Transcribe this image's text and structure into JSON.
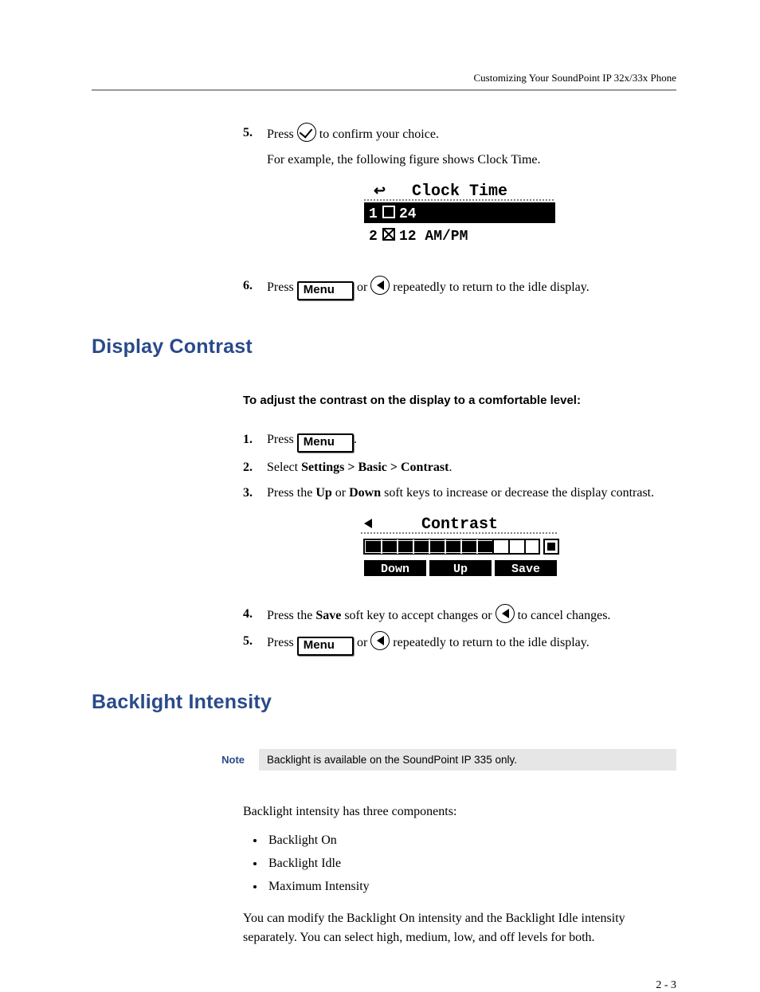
{
  "header": "Customizing Your SoundPoint IP 32x/33x Phone",
  "page_num": "2 - 3",
  "sec1": {
    "step5_num": "5.",
    "step5a": "Press ",
    "step5b": " to confirm your choice.",
    "step5_body2": "For example, the following figure shows Clock Time.",
    "lcd_title": "Clock Time",
    "lcd_line1_num": "1",
    "lcd_line1_val": "24",
    "lcd_line2_num": "2",
    "lcd_line2_val": "12 AM/PM",
    "step6_num": "6.",
    "step6a": "Press ",
    "step6b": " or ",
    "step6c": " repeatedly to return to the idle display.",
    "menu_label": "Menu"
  },
  "sec2": {
    "heading": "Display Contrast",
    "subheading": "To adjust the contrast on the display to a comfortable level:",
    "step1_num": "1.",
    "step1a": "Press ",
    "step1b": ".",
    "menu_label": "Menu",
    "step2_num": "2.",
    "step2a": "Select ",
    "step2b": "Settings > Basic > Contrast",
    "step2c": ".",
    "step3_num": "3.",
    "step3a": "Press the ",
    "step3b": "Up",
    "step3c": " or ",
    "step3d": "Down",
    "step3e": " soft keys to increase or decrease the display contrast.",
    "lcd_title": "Contrast",
    "lcd_soft1": "Down",
    "lcd_soft2": "Up",
    "lcd_soft3": "Save",
    "step4_num": "4.",
    "step4a": "Press the ",
    "step4b": "Save",
    "step4c": " soft key to accept changes or ",
    "step4d": " to cancel changes.",
    "step5_num": "5.",
    "step5a": "Press ",
    "step5b": " or ",
    "step5c": " repeatedly to return to the idle display."
  },
  "sec3": {
    "heading": "Backlight Intensity",
    "note_label": "Note",
    "note_body": "Backlight is available on the SoundPoint IP 335 only.",
    "para1": "Backlight intensity has three components:",
    "bullets": {
      "b1": "Backlight On",
      "b2": "Backlight Idle",
      "b3": "Maximum Intensity"
    },
    "para2": "You can modify the Backlight On intensity and the Backlight Idle intensity separately. You can select high, medium, low, and off levels for both."
  }
}
